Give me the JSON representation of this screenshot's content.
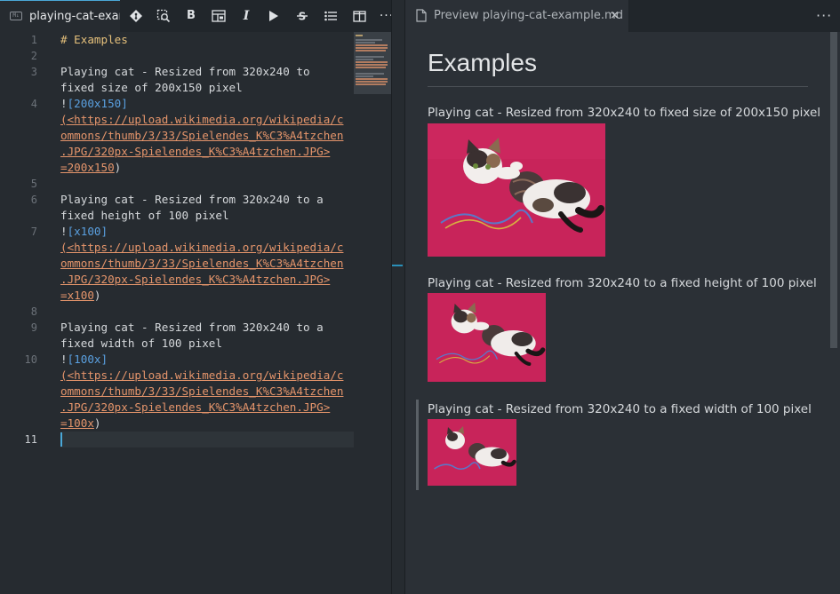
{
  "editor": {
    "tab_title": "playing-cat-example.md",
    "tab_icon": "markdown-file-icon",
    "toolbar": [
      {
        "name": "git-icon"
      },
      {
        "name": "find-replace-icon"
      },
      {
        "name": "bold-button",
        "label": "B"
      },
      {
        "name": "insert-table-icon"
      },
      {
        "name": "italic-button",
        "label": "I"
      },
      {
        "name": "run-icon"
      },
      {
        "name": "strikethrough-icon"
      },
      {
        "name": "bullet-list-icon"
      },
      {
        "name": "split-editor-icon"
      },
      {
        "name": "more-actions-icon",
        "label": "···"
      }
    ],
    "line_numbers": [
      "1",
      "2",
      "3",
      "4",
      "5",
      "6",
      "7",
      "8",
      "9",
      "10",
      "11"
    ],
    "current_line": "11",
    "code": {
      "l1": "# Examples",
      "l3a": "Playing cat - Resized from 320x240 to",
      "l3b": "fixed size of 200x150 pixel",
      "l4_bang": "!",
      "l4_alt": "[200x150]",
      "l4_url1": "(<https://upload.wikimedia.org/wikipedia/c",
      "l4_url2": "ommons/thumb/3/33/Spielendes_K%C3%A4tzchen",
      "l4_url3": ".JPG/320px-Spielendes_K%C3%A4tzchen.JPG>",
      "l4_size": "=200x150",
      "l4_close": ")",
      "l6a": "Playing cat - Resized from 320x240 to a",
      "l6b": "fixed height of 100 pixel",
      "l7_bang": "!",
      "l7_alt": "[x100]",
      "l7_url1": "(<https://upload.wikimedia.org/wikipedia/c",
      "l7_url2": "ommons/thumb/3/33/Spielendes_K%C3%A4tzchen",
      "l7_url3": ".JPG/320px-Spielendes_K%C3%A4tzchen.JPG>",
      "l7_size": "=x100",
      "l7_close": ")",
      "l9a": "Playing cat - Resized from 320x240 to a",
      "l9b": "fixed width of 100 pixel",
      "l10_bang": "!",
      "l10_alt": "[100x]",
      "l10_url1": "(<https://upload.wikimedia.org/wikipedia/c",
      "l10_url2": "ommons/thumb/3/33/Spielendes_K%C3%A4tzchen",
      "l10_url3": ".JPG/320px-Spielendes_K%C3%A4tzchen.JPG>",
      "l10_size": "=100x",
      "l10_close": ")"
    }
  },
  "preview": {
    "tab_title": "Preview playing-cat-example.md",
    "close_label": "×",
    "more_label": "···",
    "heading": "Examples",
    "captions": [
      "Playing cat - Resized from 320x240 to fixed size of 200x150 pixel",
      "Playing cat - Resized from 320x240 to a fixed height of 100 pixel",
      "Playing cat - Resized from 320x240 to a fixed width of 100 pixel"
    ]
  },
  "colors": {
    "background": "#262b30",
    "accent": "#4aa8d8",
    "heading": "#e5c07b",
    "link": "#5aa0e0",
    "url": "#e5956b",
    "photo_background": "#c8245a"
  }
}
